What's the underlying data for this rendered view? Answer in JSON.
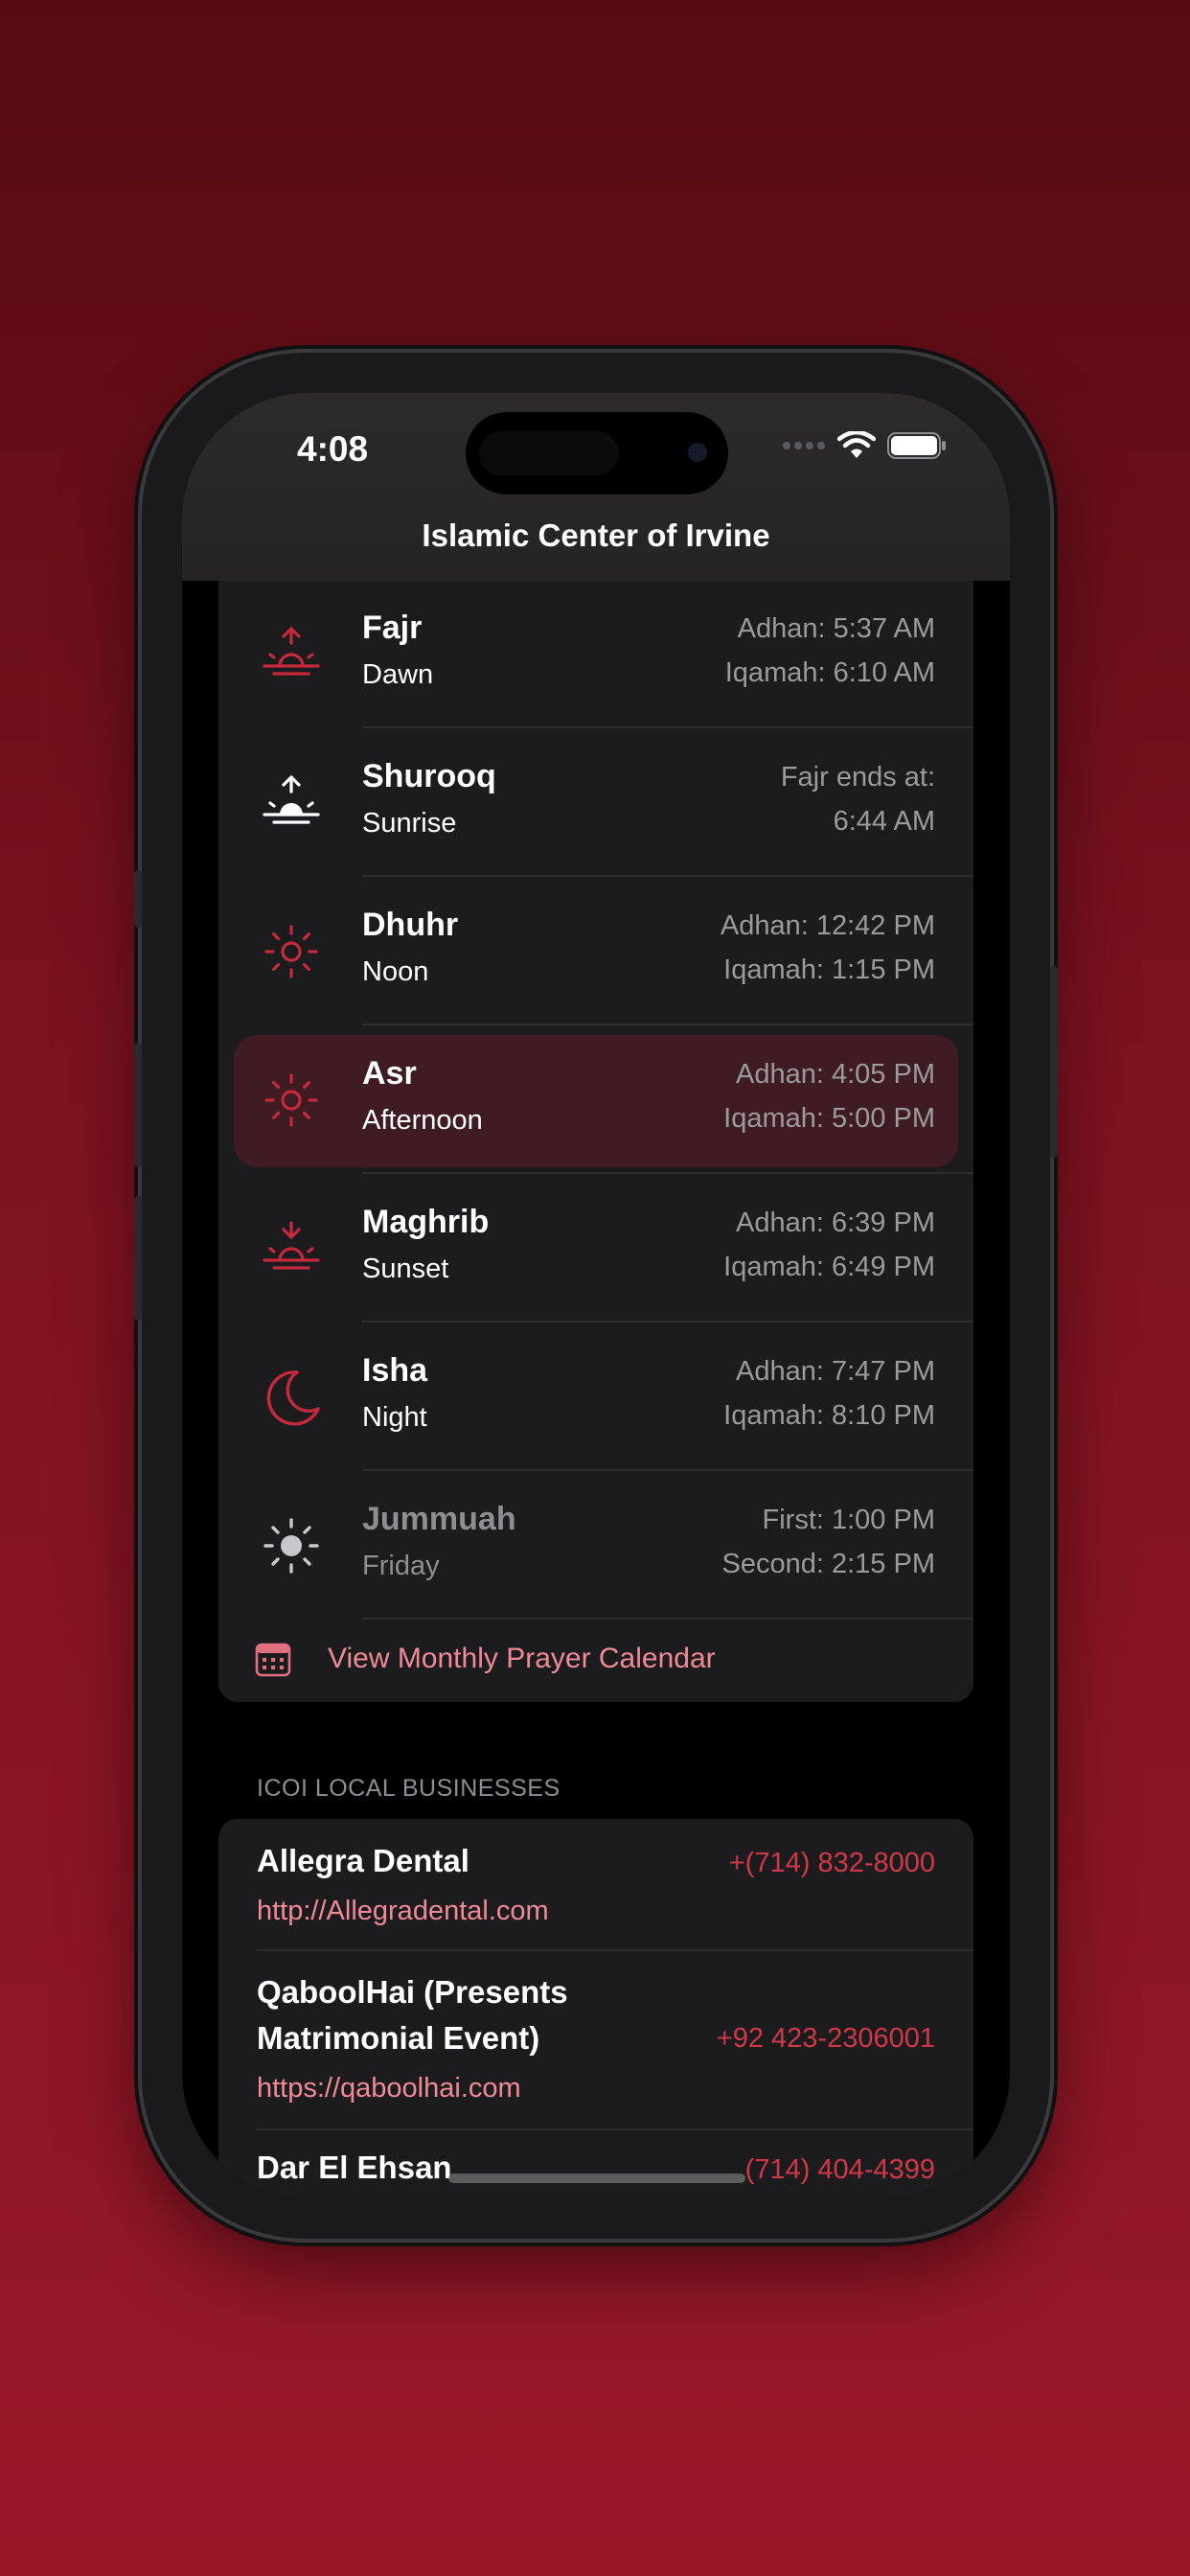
{
  "status_bar": {
    "time": "4:08"
  },
  "nav": {
    "title": "Islamic Center of Irvine"
  },
  "prayers": [
    {
      "name": "Fajr",
      "sub": "Dawn",
      "line1": "Adhan: 5:37 AM",
      "line2": "Iqamah: 6:10 AM",
      "icon": "sunrise-up-icon"
    },
    {
      "name": "Shurooq",
      "sub": "Sunrise",
      "line1": "Fajr ends at:",
      "line2": "6:44 AM",
      "icon": "sunrise-filled-icon"
    },
    {
      "name": "Dhuhr",
      "sub": "Noon",
      "line1": "Adhan: 12:42 PM",
      "line2": "Iqamah: 1:15 PM",
      "icon": "sun-icon"
    },
    {
      "name": "Asr",
      "sub": "Afternoon",
      "line1": "Adhan: 4:05 PM",
      "line2": "Iqamah: 5:00 PM",
      "icon": "sun-icon"
    },
    {
      "name": "Maghrib",
      "sub": "Sunset",
      "line1": "Adhan: 6:39 PM",
      "line2": "Iqamah: 6:49 PM",
      "icon": "sunset-down-icon"
    },
    {
      "name": "Isha",
      "sub": "Night",
      "line1": "Adhan: 7:47 PM",
      "line2": "Iqamah: 8:10 PM",
      "icon": "moon-icon"
    },
    {
      "name": "Jummuah",
      "sub": "Friday",
      "line1": "First: 1:00 PM",
      "line2": "Second: 2:15 PM",
      "icon": "sun-filled-icon"
    }
  ],
  "calendar_link": "View Monthly Prayer Calendar",
  "businesses_header": "ICOI LOCAL BUSINESSES",
  "businesses": [
    {
      "name": "Allegra Dental",
      "url": "http://Allegradental.com",
      "phone": "+(714) 832-8000"
    },
    {
      "name": "QaboolHai (Presents Matrimonial Event)",
      "url": "https://qaboolhai.com",
      "phone": "+92 423-2306001"
    },
    {
      "name": "Dar El Ehsan",
      "phone": "(714) 404-4399"
    }
  ],
  "colors": {
    "accent": "#d03848",
    "link": "#f08a96",
    "highlight": "#3e1c22",
    "card": "#1c1c1e"
  }
}
